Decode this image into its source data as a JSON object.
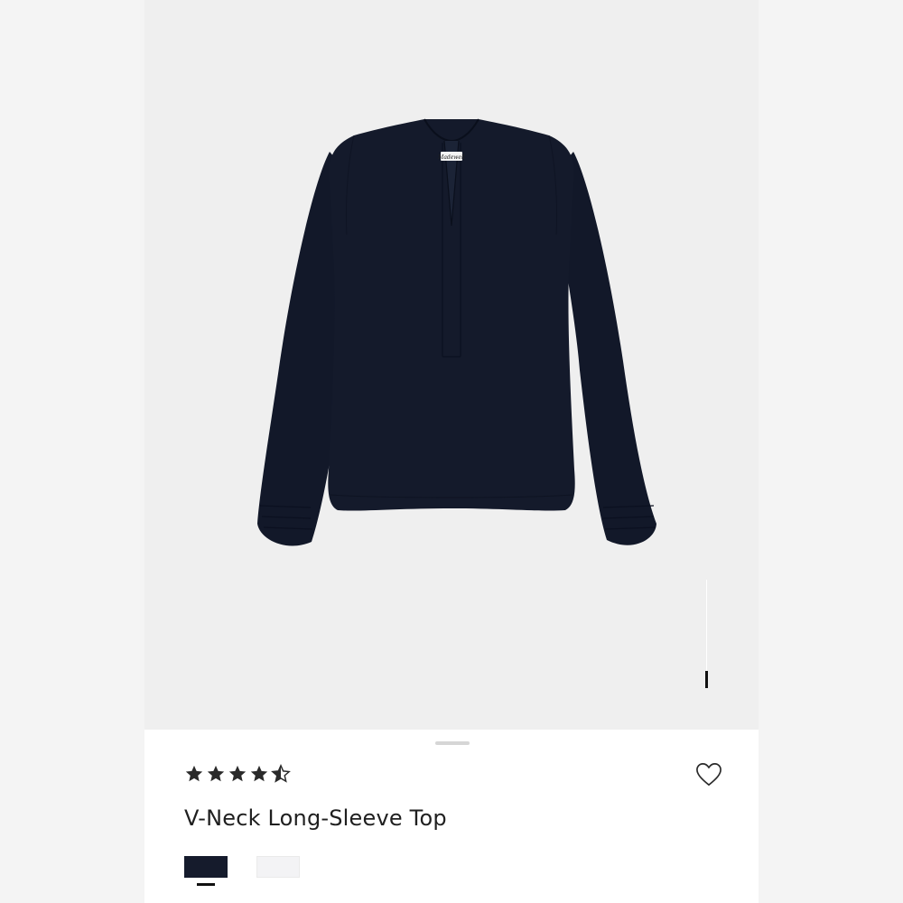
{
  "product": {
    "title": "V-Neck Long-Sleeve Top",
    "rating": 4.5,
    "rating_max": 5,
    "brand_tag": "Madewell",
    "image_alt": "Navy v-neck long-sleeve top with balloon sleeves"
  },
  "gallery": {
    "scroll_position": 0.85
  },
  "swatches": [
    {
      "name": "navy-swatch",
      "color": "#151b2c",
      "selected": true
    },
    {
      "name": "white-swatch",
      "color": "#f3f3f5",
      "selected": false
    }
  ],
  "icons": {
    "wishlist": "heart-outline-icon",
    "star": "star-icon"
  },
  "colors": {
    "background": "#f1f1f1",
    "sheet": "#ffffff",
    "garment": "#141a2b",
    "text": "#1f1f1f",
    "star": "#2a2a2a"
  }
}
